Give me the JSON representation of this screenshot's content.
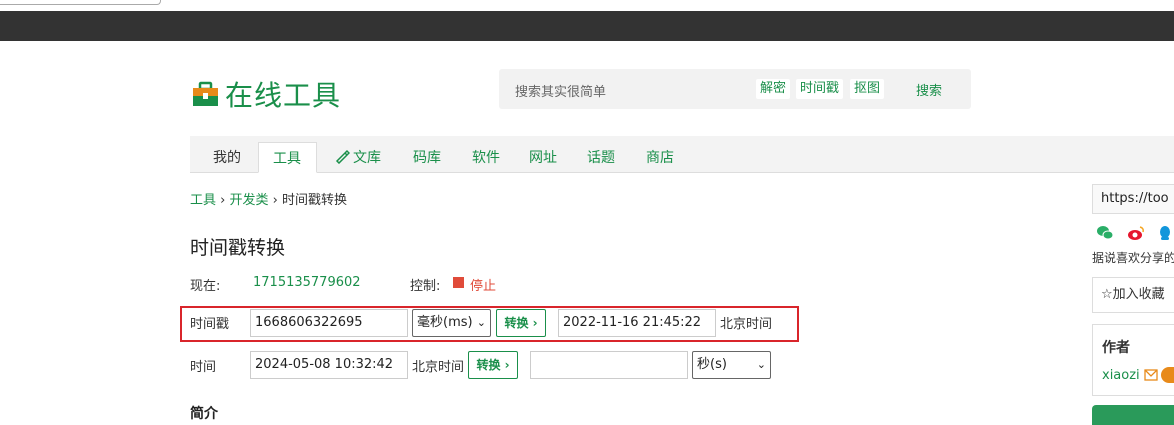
{
  "site": {
    "title": "在线工具"
  },
  "search": {
    "placeholder": "搜索其实很简单",
    "tags": [
      "解密",
      "时间戳",
      "抠图"
    ],
    "button": "搜索"
  },
  "nav": {
    "items": [
      "我的",
      "工具",
      "文库",
      "码库",
      "软件",
      "网址",
      "话题",
      "商店"
    ],
    "active": "工具"
  },
  "breadcrumb": {
    "root": "工具",
    "category": "开发类",
    "current": "时间戳转换",
    "sep": "›"
  },
  "page": {
    "title": "时间戳转换"
  },
  "now_row": {
    "label": "现在:",
    "value": "1715135779602",
    "control_label": "控制:",
    "stop_label": "停止"
  },
  "ts_row": {
    "label": "时间戳",
    "timestamp_value": "1668606322695",
    "unit_selected": "毫秒(ms)",
    "convert_button": "转换 ›",
    "result_value": "2022-11-16 21:45:22",
    "tz_label": "北京时间"
  },
  "time_row": {
    "label": "时间",
    "time_value": "2024-05-08 10:32:42",
    "tz_label": "北京时间",
    "convert_button": "转换 ›",
    "result_value": "",
    "unit_selected": "秒(s)"
  },
  "intro": {
    "heading": "简介"
  },
  "sidebar": {
    "url_text": "https://too",
    "share_text": "据说喜欢分享的",
    "fav_label": "☆加入收藏",
    "author_heading": "作者",
    "author_name": "xiaozi"
  },
  "colors": {
    "brand_green": "#1a8f4a",
    "stop_red": "#e04b3a",
    "highlight_red": "#d9252b",
    "top_bar": "#333333"
  }
}
